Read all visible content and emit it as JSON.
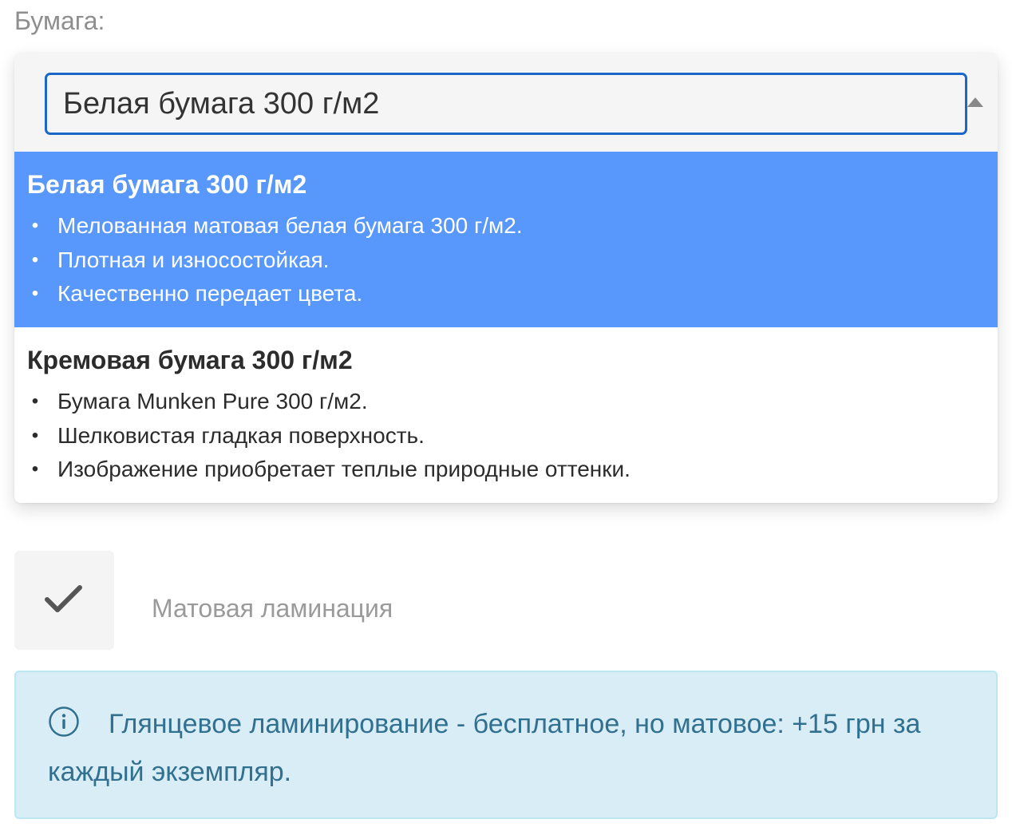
{
  "paper_field": {
    "label": "Бумага:",
    "search_value": "Белая бумага 300 г/м2"
  },
  "options": [
    {
      "title": "Белая бумага 300 г/м2",
      "highlighted": true,
      "bullets": [
        "Мелованная матовая белая бумага 300 г/м2.",
        "Плотная и износостойкая.",
        "Качественно передает цвета."
      ]
    },
    {
      "title": "Кремовая бумага 300 г/м2",
      "highlighted": false,
      "bullets": [
        "Бумага Munken Pure 300 г/м2.",
        "Шелковистая гладкая поверхность.",
        "Изображение приобретает теплые природные оттенки."
      ]
    }
  ],
  "lamination": {
    "label": "Матовая ламинация",
    "checked": true
  },
  "info": {
    "text": "Глянцевое ламинирование - бесплатное, но матовое: +15 грн за каждый экземпляр."
  },
  "colors": {
    "highlight": "#5897fb",
    "focus_border": "#1a66c9",
    "info_background": "#d9edf7",
    "info_text": "#31708f"
  },
  "icons": {
    "dropdown": "caret-up-icon",
    "checkbox": "checkmark-icon",
    "info": "info-circle-icon"
  }
}
